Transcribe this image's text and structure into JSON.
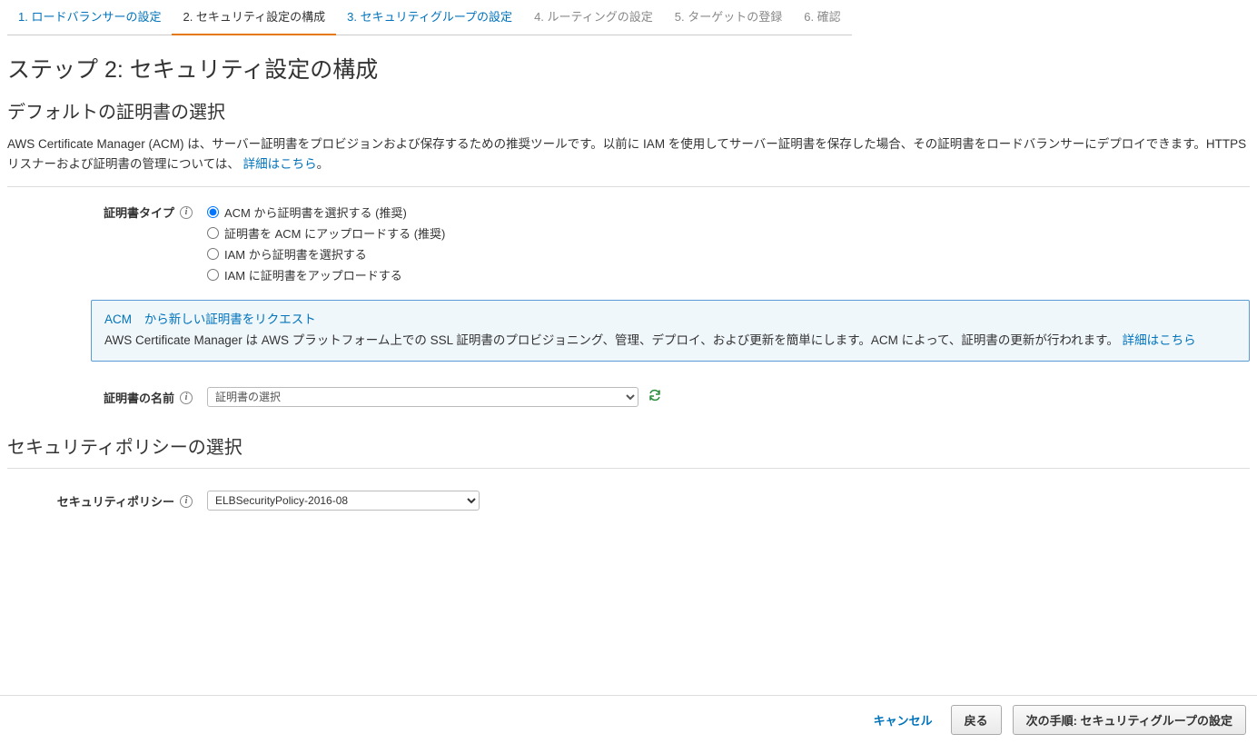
{
  "wizard": {
    "tabs": [
      {
        "label": "1. ロードバランサーの設定",
        "clickable": true
      },
      {
        "label": "2. セキュリティ設定の構成",
        "active": true
      },
      {
        "label": "3. セキュリティグループの設定",
        "clickable": true
      },
      {
        "label": "4. ルーティングの設定"
      },
      {
        "label": "5. ターゲットの登録"
      },
      {
        "label": "6. 確認"
      }
    ]
  },
  "page_title": "ステップ 2: セキュリティ設定の構成",
  "section1": {
    "title": "デフォルトの証明書の選択",
    "desc_part1": "AWS Certificate Manager (ACM) は、サーバー証明書をプロビジョンおよび保存するための推奨ツールです。以前に IAM を使用してサーバー証明書を保存した場合、その証明書をロードバランサーにデプロイできます。HTTPS リスナーおよび証明書の管理については、 ",
    "desc_link": "詳細はこちら",
    "desc_part2": "。"
  },
  "certificate_type": {
    "label": "証明書タイプ",
    "options": [
      "ACM から証明書を選択する (推奨)",
      "証明書を ACM にアップロードする (推奨)",
      "IAM から証明書を選択する",
      "IAM に証明書をアップロードする"
    ],
    "selected": 0
  },
  "acm_box": {
    "acm_label": "ACM",
    "request_link": "から新しい証明書をリクエスト",
    "desc": "AWS Certificate Manager は AWS プラットフォーム上での SSL 証明書のプロビジョニング、管理、デプロイ、および更新を簡単にします。ACM によって、証明書の更新が行われます。 ",
    "more_link": "詳細はこちら"
  },
  "certificate_name": {
    "label": "証明書の名前",
    "placeholder": "証明書の選択"
  },
  "section2": {
    "title": "セキュリティポリシーの選択"
  },
  "security_policy": {
    "label": "セキュリティポリシー",
    "selected": "ELBSecurityPolicy-2016-08"
  },
  "footer": {
    "cancel": "キャンセル",
    "back": "戻る",
    "next": "次の手順: セキュリティグループの設定"
  }
}
